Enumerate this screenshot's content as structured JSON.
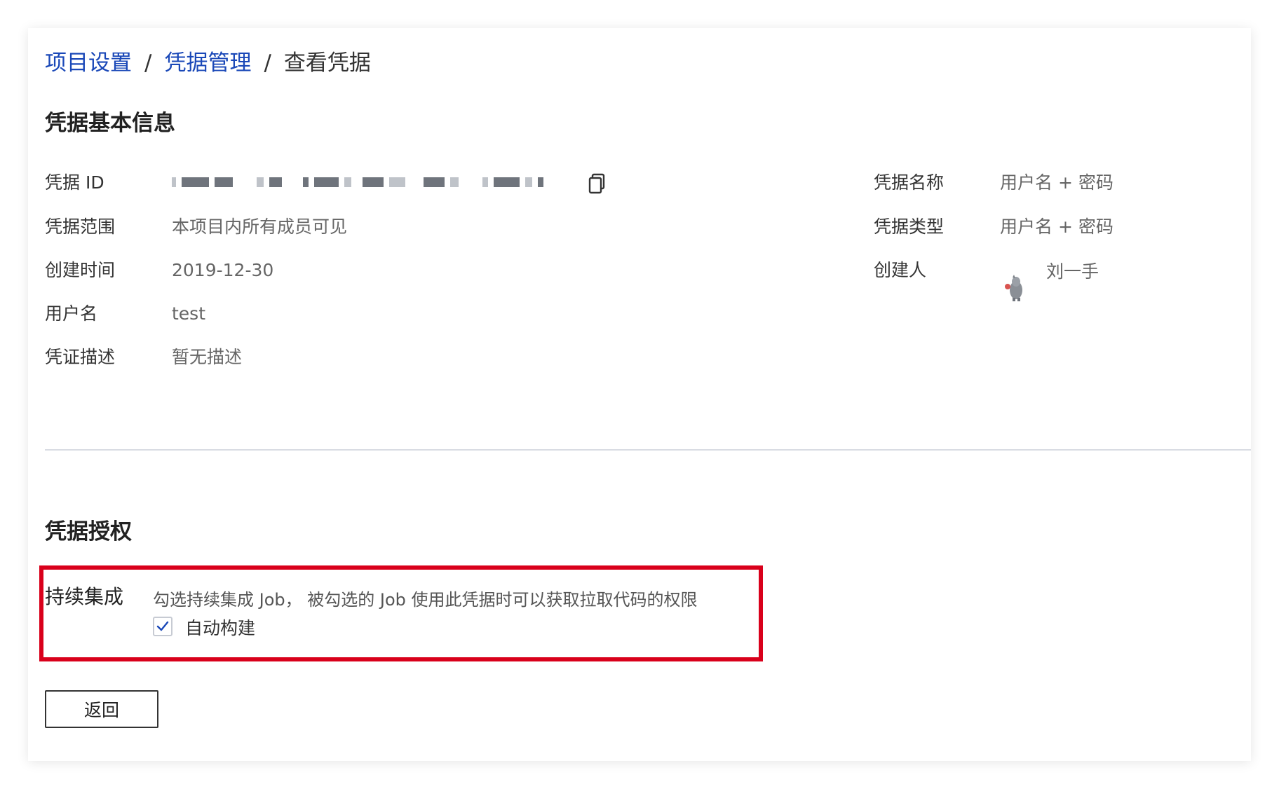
{
  "breadcrumb": {
    "items": [
      "项目设置",
      "凭据管理"
    ],
    "separator": "/",
    "current": "查看凭据"
  },
  "basic_info": {
    "title": "凭据基本信息",
    "left": [
      {
        "label": "凭据 ID",
        "value": ""
      },
      {
        "label": "凭据范围",
        "value": "本项目内所有成员可见"
      },
      {
        "label": "创建时间",
        "value": "2019-12-30"
      },
      {
        "label": "用户名",
        "value": "test"
      },
      {
        "label": "凭证描述",
        "value": "暂无描述"
      }
    ],
    "right": [
      {
        "label": "凭据名称",
        "value": "用户名 + 密码"
      },
      {
        "label": "凭据类型",
        "value": "用户名 + 密码"
      },
      {
        "label": "创建人",
        "value": "刘一手"
      }
    ],
    "id_masked": true,
    "copy_icon": "copy-icon",
    "avatar_icon": "user-avatar-icon"
  },
  "authorization": {
    "title": "凭据授权",
    "ci_label": "持续集成",
    "description": "勾选持续集成 Job， 被勾选的 Job 使用此凭据时可以获取拉取代码的权限",
    "jobs": [
      {
        "label": "自动构建",
        "checked": true
      }
    ],
    "highlight_color": "#d9001b"
  },
  "actions": {
    "back_label": "返回"
  },
  "colors": {
    "link": "#1a48b8",
    "checkbox_tick": "#1a48b8"
  }
}
